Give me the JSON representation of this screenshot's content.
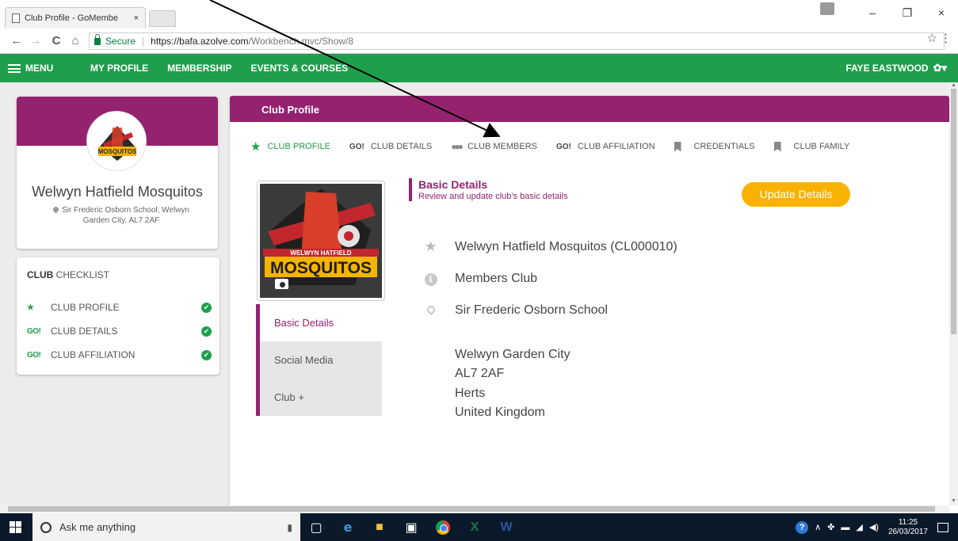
{
  "browser": {
    "tab_title": "Club Profile - GoMembe",
    "tab_close": "×",
    "secure_label": "Secure",
    "url_host": "https://bafa.azolve.com",
    "url_path": "/Workbench.mvc/Show/8",
    "back": "←",
    "forward": "→",
    "reload": "C",
    "home": "⌂",
    "star": "☆",
    "menu": "⋮",
    "minimize": "–",
    "restore": "❐",
    "close": "×"
  },
  "topnav": {
    "menu_label": "MENU",
    "links": [
      "MY PROFILE",
      "MEMBERSHIP",
      "EVENTS & COURSES"
    ],
    "user_name": "FAYE EASTWOOD",
    "gear": "✿▾"
  },
  "club_card": {
    "name": "Welwyn Hatfield Mosquitos",
    "address": "Sir Frederic Osborn School, Welwyn Garden City, AL7 2AF",
    "logo_top_text": "WELWYN HATFIELD",
    "logo_main_text": "MOSQUITOS"
  },
  "checklist": {
    "title_bold": "CLUB",
    "title_rest": " CHECKLIST",
    "items": [
      {
        "icon": "★",
        "label": "CLUB PROFILE",
        "status": "✔"
      },
      {
        "icon": "GO!",
        "label": "CLUB DETAILS",
        "status": "✔"
      },
      {
        "icon": "GO!",
        "label": "CLUB AFFILIATION",
        "status": "✔"
      }
    ]
  },
  "main": {
    "header_title": "Club Profile",
    "tabs": [
      {
        "icon": "★",
        "label": "CLUB PROFILE"
      },
      {
        "icon": "GO!",
        "label": "CLUB DETAILS"
      },
      {
        "icon": "👥",
        "label": "CLUB MEMBERS"
      },
      {
        "icon": "GO!",
        "label": "CLUB AFFILIATION"
      },
      {
        "icon": "bookmark",
        "label": "CREDENTIALS"
      },
      {
        "icon": "bookmark",
        "label": "CLUB FAMILY"
      }
    ],
    "side_menu": [
      "Basic Details",
      "Social Media",
      "Club +"
    ],
    "section_title": "Basic Details",
    "section_subtitle": "Review and update club's basic details",
    "update_button": "Update Details",
    "details": {
      "club_name_id": "Welwyn Hatfield Mosquitos (CL000010)",
      "club_type": "Members Club",
      "address_line1": "Sir Frederic Osborn School",
      "address_city": "Welwyn Garden City",
      "address_postcode": "AL7 2AF",
      "address_county": "Herts",
      "address_country": "United Kingdom"
    }
  },
  "taskbar": {
    "search_placeholder": "Ask me anything",
    "clock_time": "11:25",
    "clock_date": "26/03/2017",
    "help": "?"
  },
  "colors": {
    "brand_green": "#1f9e4b",
    "brand_purple": "#94226f",
    "accent_yellow": "#f9b200"
  }
}
